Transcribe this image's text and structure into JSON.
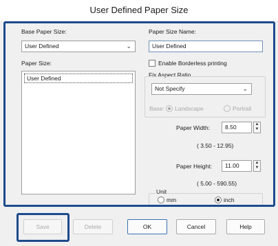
{
  "window": {
    "title": "User Defined Paper Size"
  },
  "base_paper_size": {
    "label": "Base Paper Size:",
    "value": "User Defined"
  },
  "paper_size_name": {
    "label": "Paper Size Name:",
    "value": "User Defined"
  },
  "paper_size": {
    "label": "Paper Size:",
    "items": [
      "User Defined"
    ]
  },
  "borderless": {
    "label": "Enable Borderless printing",
    "checked": false
  },
  "aspect_ratio": {
    "label": "Fix Aspect Ratio",
    "value": "Not Specify",
    "base_label": "Base:",
    "landscape_label": "Landscape",
    "portrait_label": "Portrait",
    "selected": "landscape"
  },
  "paper_width": {
    "label": "Paper Width:",
    "value": "8.50",
    "range": "( 3.50 - 12.95)"
  },
  "paper_height": {
    "label": "Paper Height:",
    "value": "11.00",
    "range": "( 5.00 - 590.55)"
  },
  "unit": {
    "label": "Unit",
    "mm_label": "mm",
    "inch_label": "inch",
    "selected": "inch"
  },
  "buttons": {
    "save": "Save",
    "delete": "Delete",
    "ok": "OK",
    "cancel": "Cancel",
    "help": "Help"
  },
  "colors": {
    "highlight": "#1d4a8c",
    "dialog_bg": "#f0f0f0"
  },
  "icons": {
    "dropdown": "chevron-down-icon",
    "spin": "spin-arrows-icon"
  }
}
